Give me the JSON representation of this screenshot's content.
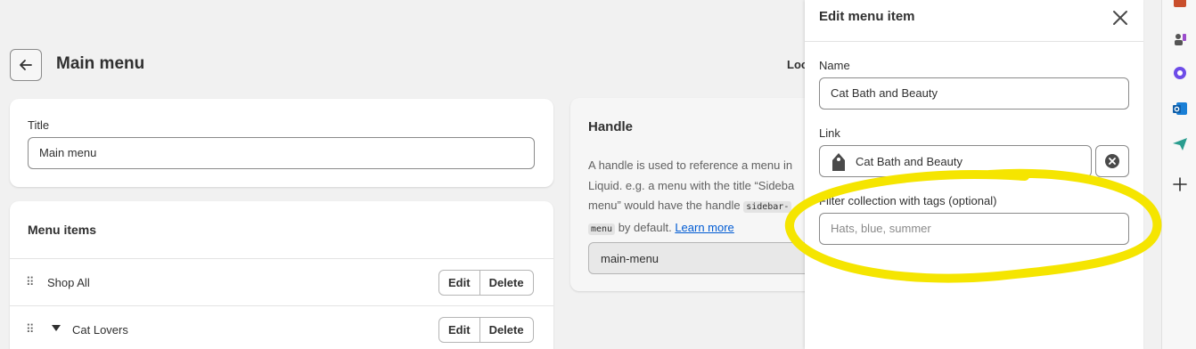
{
  "header": {
    "back_icon": "arrow-left-icon",
    "title": "Main menu",
    "location_label": "Loc"
  },
  "title_card": {
    "label": "Title",
    "value": "Main menu"
  },
  "menu_items": {
    "heading": "Menu items",
    "items": [
      {
        "label": "Shop All",
        "has_children": false
      },
      {
        "label": "Cat Lovers",
        "has_children": true
      }
    ],
    "edit_label": "Edit",
    "delete_label": "Delete"
  },
  "handle_card": {
    "heading": "Handle",
    "desc_line1": "A handle is used to reference a menu in",
    "desc_line2": "Liquid. e.g. a menu with the title “Sideba",
    "desc_line3_pre": "menu” would have the handle ",
    "desc_code1": "sidebar-",
    "desc_code2": "menu",
    "desc_line4_post": " by default. ",
    "learn_more": "Learn more",
    "handle_value": "main-menu"
  },
  "edit_panel": {
    "title": "Edit menu item",
    "close_icon": "close-icon",
    "name_label": "Name",
    "name_value": "Cat Bath and Beauty",
    "link_label": "Link",
    "link_value": "Cat Bath and Beauty",
    "link_icon": "collection-tag-icon",
    "clear_icon": "clear-circle-icon",
    "filter_label": "Filter collection with tags (optional)",
    "filter_placeholder": "Hats, blue, summer"
  },
  "colors": {
    "highlight": "#f5e500",
    "link": "#005bd3"
  }
}
